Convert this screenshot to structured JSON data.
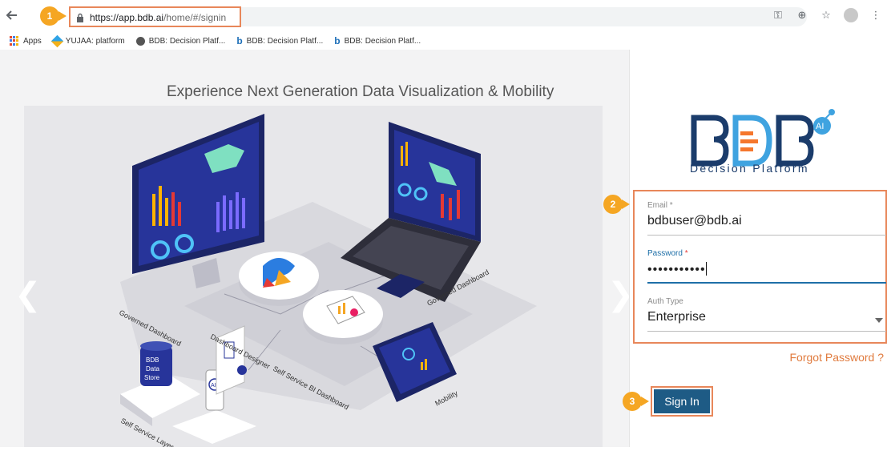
{
  "browser": {
    "url_host": "https://app.bdb.ai",
    "url_path": "/home/#/signin",
    "steps": [
      "1",
      "2",
      "3"
    ],
    "bookmarks": [
      {
        "label": "Apps",
        "icon": "apps-grid-icon"
      },
      {
        "label": "YUJAA: platform",
        "icon": "cube-icon"
      },
      {
        "label": "BDB: Decision Platf...",
        "icon": "globe-icon"
      },
      {
        "label": "BDB: Decision Platf...",
        "icon": "bdb-b-icon"
      },
      {
        "label": "BDB: Decision Platf...",
        "icon": "bdb-b-icon"
      }
    ],
    "toolbar_icons": [
      "key-icon",
      "zoom-icon",
      "star-icon",
      "profile-icon",
      "menu-icon"
    ]
  },
  "carousel": {
    "headline": "Experience Next Generation Data Visualization & Mobility",
    "prev_glyph": "❮",
    "next_glyph": "❯",
    "labels": {
      "governed_left": "Governed Dashboard",
      "governed_right": "Governed Dashboard",
      "designer": "Dashboard Designer",
      "self_bi": "Self Service BI Dashboard",
      "mobility": "Mobility",
      "self_layer": "Self Service Layer",
      "datastore_1": "BDB",
      "datastore_2": "Data",
      "datastore_3": "Store",
      "ai": "AI"
    }
  },
  "login": {
    "logo_text": "BDB",
    "logo_badge": "AI",
    "tagline": "Decision Platform",
    "email": {
      "label": "Email",
      "required": "*",
      "value": "bdbuser@bdb.ai"
    },
    "password": {
      "label": "Password",
      "required": "*",
      "masked_value": "•••••••••••"
    },
    "auth_type": {
      "label": "Auth Type",
      "value": "Enterprise"
    },
    "forgot": "Forgot Password ?",
    "signin": "Sign In"
  },
  "colors": {
    "accent_orange": "#e8875a",
    "step_badge": "#f5a623",
    "primary_blue": "#1e5b85",
    "logo_dark": "#1b3c6b",
    "logo_light": "#3fa3e0"
  }
}
